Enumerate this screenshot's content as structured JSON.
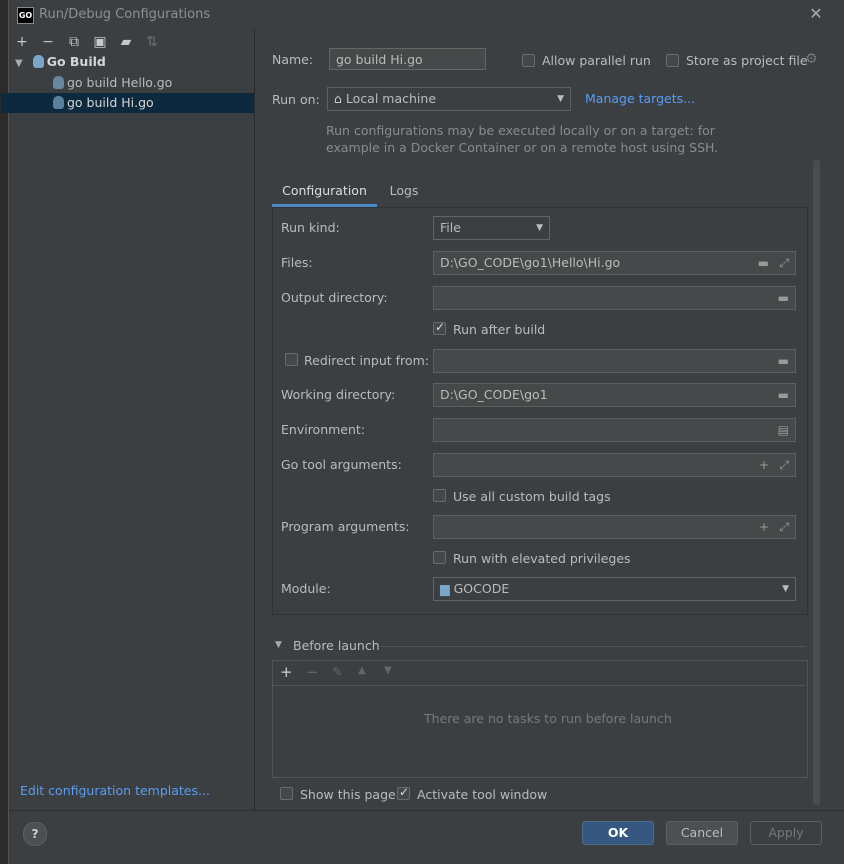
{
  "window": {
    "title": "Run/Debug Configurations",
    "logo": "GO"
  },
  "toolbar": [
    "add-icon",
    "remove-icon",
    "copy-icon",
    "save-icon",
    "folder-add-icon",
    "sort-icon"
  ],
  "tree": {
    "group": "Go Build",
    "items": [
      "go build Hello.go",
      "go build Hi.go"
    ]
  },
  "edit_templates": "Edit configuration templates...",
  "name": {
    "label": "Name:",
    "value": "go build Hi.go"
  },
  "allow_parallel": "Allow parallel run",
  "store_project": "Store as project file",
  "run_on": {
    "label": "Run on:",
    "value": "Local machine",
    "manage": "Manage targets..."
  },
  "run_on_hint_1": "Run configurations may be executed locally or on a target: for",
  "run_on_hint_2": "example in a Docker Container or on a remote host using SSH.",
  "tabs": [
    "Configuration",
    "Logs"
  ],
  "config": {
    "run_kind_label": "Run kind:",
    "run_kind_value": "File",
    "files_label": "Files:",
    "files_value": "D:\\GO_CODE\\go1\\Hello\\Hi.go",
    "output_label": "Output directory:",
    "output_value": "",
    "run_after_build": "Run after build",
    "redirect_label": "Redirect input from:",
    "working_label": "Working directory:",
    "working_value": "D:\\GO_CODE\\go1",
    "env_label": "Environment:",
    "go_tool_label": "Go tool arguments:",
    "custom_tags": "Use all custom build tags",
    "program_label": "Program arguments:",
    "elevated": "Run with elevated privileges",
    "module_label": "Module:",
    "module_value": "GOCODE"
  },
  "before_launch": {
    "title": "Before launch",
    "empty": "There are no tasks to run before launch"
  },
  "show_page": "Show this page",
  "activate_tool": "Activate tool window",
  "buttons": {
    "ok": "OK",
    "cancel": "Cancel",
    "apply": "Apply",
    "help": "?"
  }
}
